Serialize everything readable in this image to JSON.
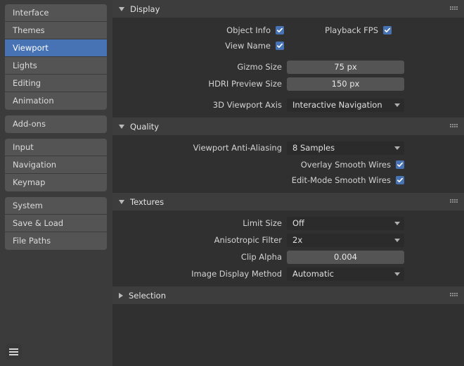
{
  "sidebar": {
    "groups": [
      {
        "items": [
          {
            "label": "Interface",
            "selected": false
          },
          {
            "label": "Themes",
            "selected": false
          },
          {
            "label": "Viewport",
            "selected": true
          },
          {
            "label": "Lights",
            "selected": false
          },
          {
            "label": "Editing",
            "selected": false
          },
          {
            "label": "Animation",
            "selected": false
          }
        ]
      },
      {
        "items": [
          {
            "label": "Add-ons",
            "selected": false
          }
        ]
      },
      {
        "items": [
          {
            "label": "Input",
            "selected": false
          },
          {
            "label": "Navigation",
            "selected": false
          },
          {
            "label": "Keymap",
            "selected": false
          }
        ]
      },
      {
        "items": [
          {
            "label": "System",
            "selected": false
          },
          {
            "label": "Save & Load",
            "selected": false
          },
          {
            "label": "File Paths",
            "selected": false
          }
        ]
      }
    ],
    "menu_icon": "hamburger-icon"
  },
  "panel_options": {
    "icon": "chevron-down-icon"
  },
  "sections": {
    "display": {
      "title": "Display",
      "expanded": true,
      "grip_icon": "grip-dots-icon",
      "object_info_label": "Object Info",
      "object_info_checked": true,
      "playback_fps_label": "Playback FPS",
      "playback_fps_checked": true,
      "view_name_label": "View Name",
      "view_name_checked": true,
      "gizmo_size_label": "Gizmo Size",
      "gizmo_size_value": "75 px",
      "hdri_preview_size_label": "HDRI Preview Size",
      "hdri_preview_size_value": "150 px",
      "viewport_axis_label": "3D Viewport Axis",
      "viewport_axis_value": "Interactive Navigation"
    },
    "quality": {
      "title": "Quality",
      "expanded": true,
      "grip_icon": "grip-dots-icon",
      "anti_aliasing_label": "Viewport Anti-Aliasing",
      "anti_aliasing_value": "8 Samples",
      "overlay_smooth_wires_label": "Overlay Smooth Wires",
      "overlay_smooth_wires_checked": true,
      "edit_mode_smooth_wires_label": "Edit-Mode Smooth Wires",
      "edit_mode_smooth_wires_checked": true
    },
    "textures": {
      "title": "Textures",
      "expanded": true,
      "grip_icon": "grip-dots-icon",
      "limit_size_label": "Limit Size",
      "limit_size_value": "Off",
      "anisotropic_filter_label": "Anisotropic Filter",
      "anisotropic_filter_value": "2x",
      "clip_alpha_label": "Clip Alpha",
      "clip_alpha_value": "0.004",
      "image_display_method_label": "Image Display Method",
      "image_display_method_value": "Automatic"
    },
    "selection": {
      "title": "Selection",
      "expanded": false,
      "grip_icon": "grip-dots-icon"
    }
  },
  "colors": {
    "accent": "#4772b3",
    "sidebar_bg": "#3b3b3b",
    "panel_bg": "#303030",
    "header_bg": "#3d3d3d",
    "field_number_bg": "#545454",
    "field_select_bg": "#2b2b2b"
  }
}
